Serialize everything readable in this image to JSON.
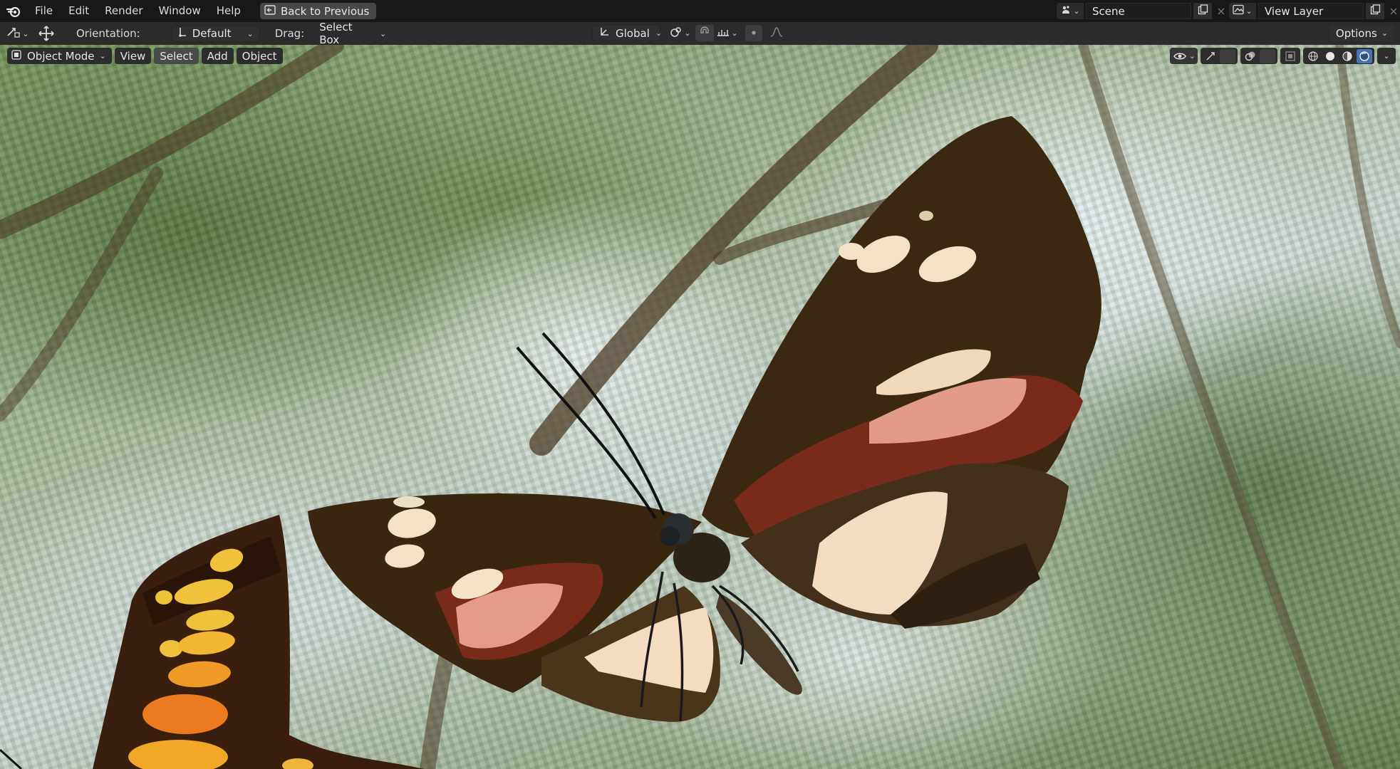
{
  "menu": {
    "items": [
      "File",
      "Edit",
      "Render",
      "Window",
      "Help"
    ],
    "back_button": "Back to Previous"
  },
  "scene_selector": {
    "name": "Scene"
  },
  "view_layer_selector": {
    "name": "View Layer"
  },
  "toolbar": {
    "orientation_label": "Orientation:",
    "orientation_value": "Default",
    "drag_label": "Drag:",
    "drag_value": "Select Box",
    "transform_orientation": "Global",
    "options_label": "Options"
  },
  "viewport_header": {
    "mode": "Object Mode",
    "menus": [
      {
        "label": "View",
        "active": false
      },
      {
        "label": "Select",
        "active": true
      },
      {
        "label": "Add",
        "active": false
      },
      {
        "label": "Object",
        "active": false
      }
    ]
  },
  "viewport_shading": {
    "active": "rendered"
  },
  "colors": {
    "accent": "#4772b3",
    "topbar": "#181818",
    "header": "#2b2b2b"
  }
}
